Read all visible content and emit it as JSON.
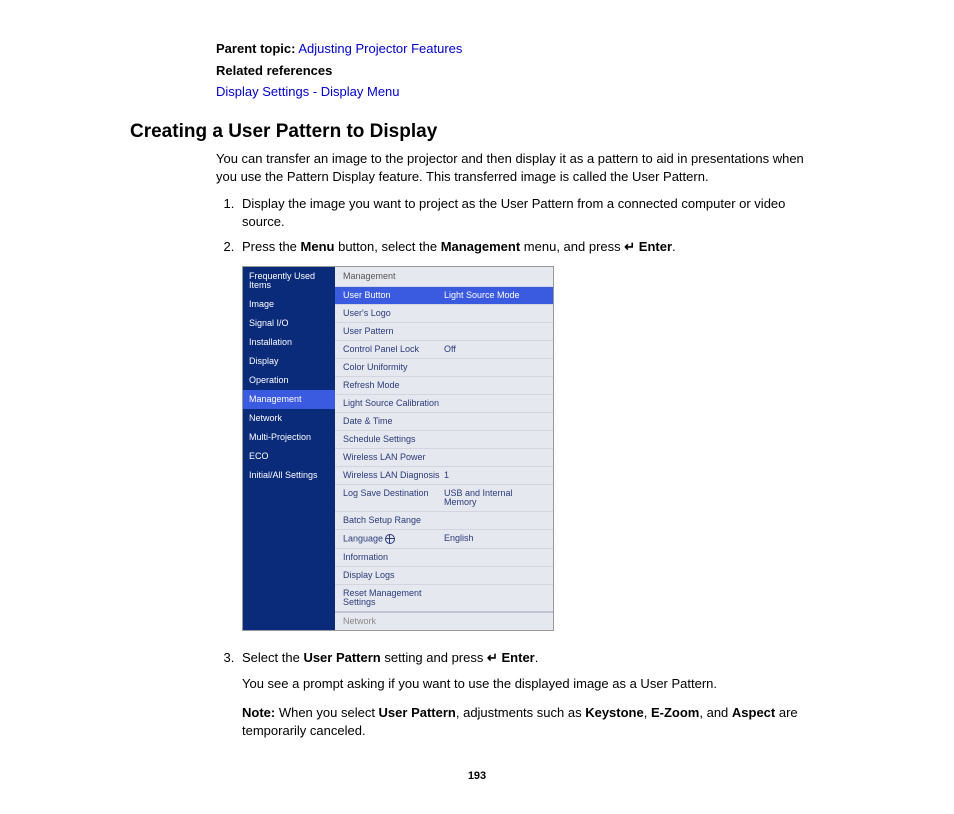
{
  "meta": {
    "parent_topic_label": "Parent topic:",
    "parent_topic_link": "Adjusting Projector Features",
    "related_refs_label": "Related references",
    "related_refs_link": "Display Settings - Display Menu"
  },
  "title": "Creating a User Pattern to Display",
  "intro": "You can transfer an image to the projector and then display it as a pattern to aid in presentations when you use the Pattern Display feature. This transferred image is called the User Pattern.",
  "steps": {
    "s1": "Display the image you want to project as the User Pattern from a connected computer or video source.",
    "s2_a": "Press the ",
    "s2_b": "Menu",
    "s2_c": " button, select the ",
    "s2_d": "Management",
    "s2_e": " menu, and press ",
    "s2_enter": "Enter",
    "s2_end": ".",
    "s3_a": "Select the ",
    "s3_b": "User Pattern",
    "s3_c": " setting and press ",
    "s3_end": ".",
    "s3_sub": "You see a prompt asking if you want to use the displayed image as a User Pattern.",
    "note_a": "Note:",
    "note_b": " When you select ",
    "note_c": "User Pattern",
    "note_d": ", adjustments such as ",
    "note_e": "Keystone",
    "note_f": ", ",
    "note_g": "E-Zoom",
    "note_h": ", and ",
    "note_i": "Aspect",
    "note_j": " are temporarily canceled."
  },
  "menu": {
    "left": [
      "Frequently Used Items",
      "Image",
      "Signal I/O",
      "Installation",
      "Display",
      "Operation",
      "Management",
      "Network",
      "Multi-Projection",
      "ECO",
      "Initial/All Settings"
    ],
    "left_selected_index": 6,
    "right_header": "Management",
    "right": [
      {
        "label": "User Button",
        "value": "Light Source Mode",
        "selected": true
      },
      {
        "label": "User's Logo",
        "value": ""
      },
      {
        "label": "User Pattern",
        "value": ""
      },
      {
        "label": "Control Panel Lock",
        "value": "Off"
      },
      {
        "label": "Color Uniformity",
        "value": ""
      },
      {
        "label": "Refresh Mode",
        "value": ""
      },
      {
        "label": "Light Source Calibration",
        "value": ""
      },
      {
        "label": "Date & Time",
        "value": ""
      },
      {
        "label": "Schedule Settings",
        "value": ""
      },
      {
        "label": "Wireless LAN Power",
        "value": ""
      },
      {
        "label": "Wireless LAN Diagnosis",
        "value": "1"
      },
      {
        "label": "Log Save Destination",
        "value": "USB and Internal Memory"
      },
      {
        "label": "Batch Setup Range",
        "value": ""
      },
      {
        "label": "Language",
        "value": "English",
        "icon": "globe"
      },
      {
        "label": "Information",
        "value": ""
      },
      {
        "label": "Display Logs",
        "value": ""
      },
      {
        "label": "Reset Management Settings",
        "value": ""
      }
    ],
    "right_footer": "Network"
  },
  "enter_glyph": "↵",
  "page_number": "193"
}
